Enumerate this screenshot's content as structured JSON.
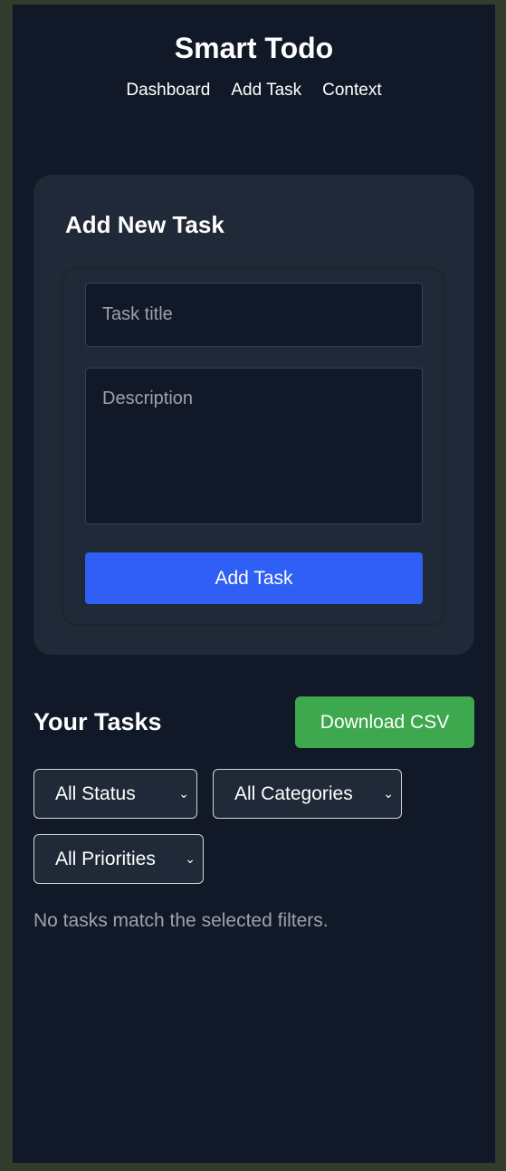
{
  "header": {
    "title": "Smart Todo",
    "nav": [
      "Dashboard",
      "Add Task",
      "Context"
    ]
  },
  "add_task": {
    "heading": "Add New Task",
    "title_placeholder": "Task title",
    "description_placeholder": "Description",
    "submit_label": "Add Task",
    "submit_color": "#2f5ff5"
  },
  "tasks": {
    "heading": "Your Tasks",
    "download_label": "Download CSV",
    "download_color": "#3ea84f",
    "filters": {
      "status": "All Status",
      "category": "All Categories",
      "priority": "All Priorities"
    },
    "empty_message": "No tasks match the selected filters."
  },
  "colors": {
    "background": "#111827",
    "card": "#1f2937",
    "muted_text": "#9ca3af"
  }
}
